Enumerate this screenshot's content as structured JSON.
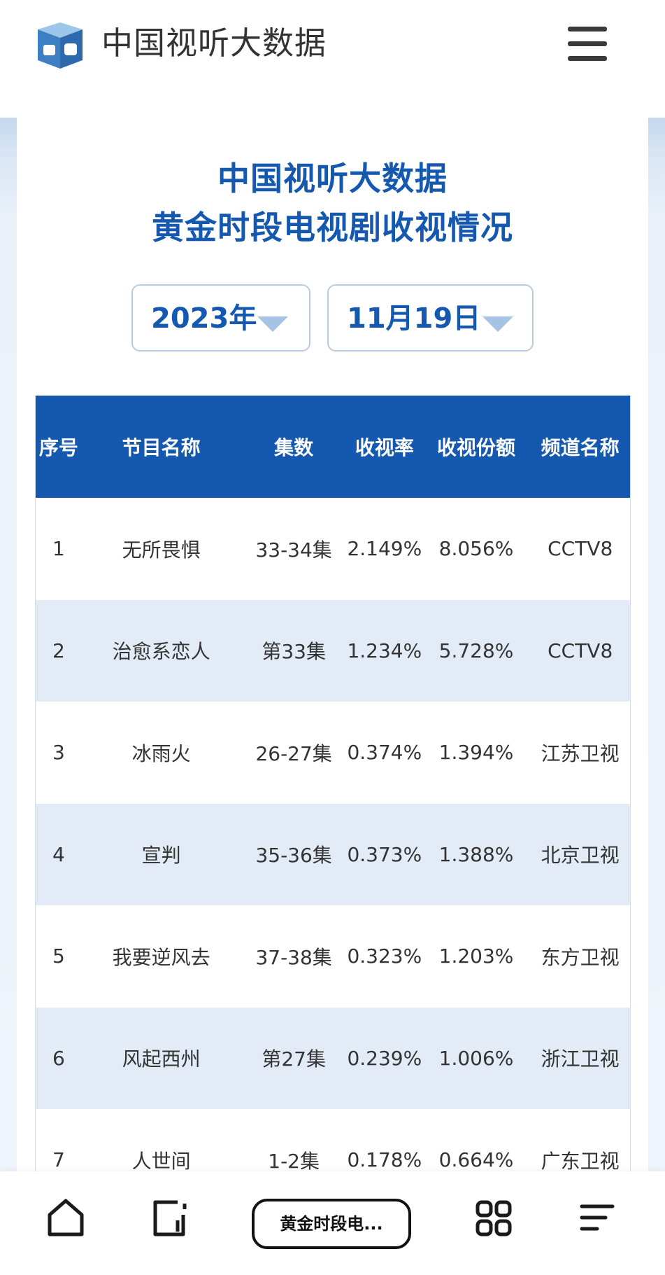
{
  "header": {
    "brand": "中国视听大数据",
    "logo_icon": "book-cube-logo-icon",
    "menu_icon": "hamburger-menu-icon"
  },
  "report": {
    "title_line1": "中国视听大数据",
    "title_line2": "黄金时段电视剧收视情况",
    "year": "2023年",
    "date": "11月19日"
  },
  "table": {
    "headers": [
      "序号",
      "节目名称",
      "集数",
      "收视率",
      "收视份额",
      "频道名称"
    ],
    "rows": [
      [
        "1",
        "无所畏惧",
        "33-34集",
        "2.149%",
        "8.056%",
        "CCTV8"
      ],
      [
        "2",
        "治愈系恋人",
        "第33集",
        "1.234%",
        "5.728%",
        "CCTV8"
      ],
      [
        "3",
        "冰雨火",
        "26-27集",
        "0.374%",
        "1.394%",
        "江苏卫视"
      ],
      [
        "4",
        "宣判",
        "35-36集",
        "0.373%",
        "1.388%",
        "北京卫视"
      ],
      [
        "5",
        "我要逆风去",
        "37-38集",
        "0.323%",
        "1.203%",
        "东方卫视"
      ],
      [
        "6",
        "风起西州",
        "第27集",
        "0.239%",
        "1.006%",
        "浙江卫视"
      ],
      [
        "7",
        "人世间",
        "1-2集",
        "0.178%",
        "0.664%",
        "广东卫视"
      ]
    ]
  },
  "bottom_bar": {
    "tab_label": "黄金时段电...",
    "icons": [
      "home-icon",
      "tabs-icon",
      "grid-apps-icon",
      "more-lines-icon"
    ]
  },
  "colors": {
    "accent": "#1558b0",
    "row_alt": "#e3ecf6",
    "dropdown_caret": "#a6c3e6"
  }
}
